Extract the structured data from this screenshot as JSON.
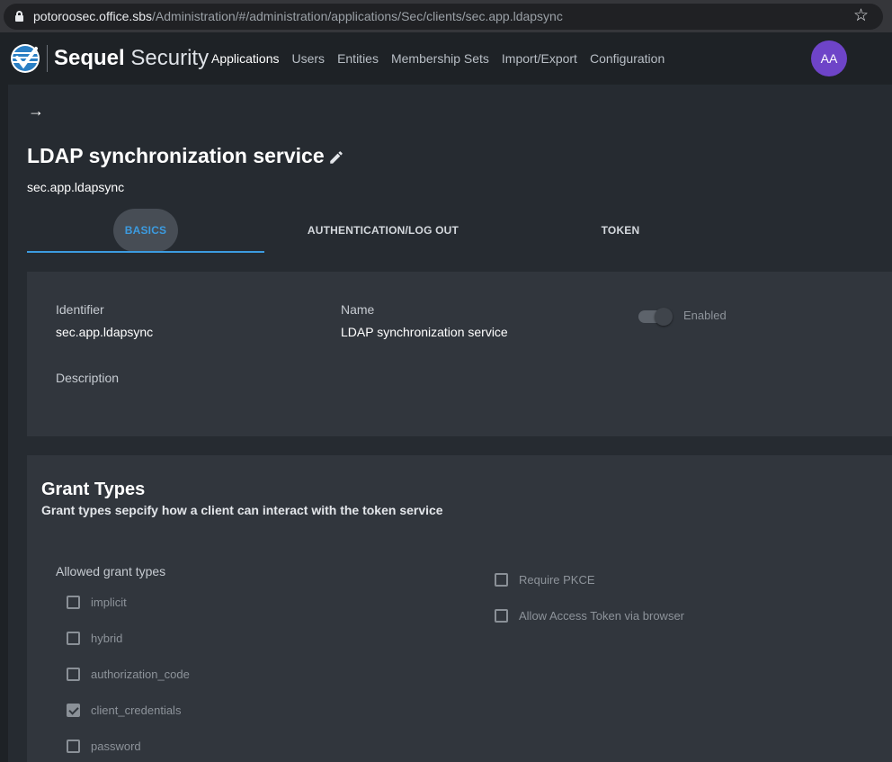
{
  "browser": {
    "url_host": "potoroosec.office.sbs",
    "url_path": "/Administration/#/administration/applications/Sec/clients/sec.app.ldapsync",
    "lock_icon": "lock-icon",
    "bookmark_icon": "star-icon"
  },
  "header": {
    "brand_bold": "Sequel",
    "brand_light": "Security",
    "nav": [
      {
        "label": "Applications",
        "active": true
      },
      {
        "label": "Users",
        "active": false
      },
      {
        "label": "Entities",
        "active": false
      },
      {
        "label": "Membership Sets",
        "active": false
      },
      {
        "label": "Import/Export",
        "active": false
      },
      {
        "label": "Configuration",
        "active": false
      }
    ],
    "avatar_initials": "AA",
    "avatar_color": "#6e44c8"
  },
  "page": {
    "back_icon": "→",
    "title": "LDAP synchronization service",
    "subtitle": "sec.app.ldapsync"
  },
  "tabs": [
    {
      "label": "BASICS",
      "active": true
    },
    {
      "label": "AUTHENTICATION/LOG OUT",
      "active": false
    },
    {
      "label": "TOKEN",
      "active": false
    }
  ],
  "basics": {
    "identifier_label": "Identifier",
    "identifier_value": "sec.app.ldapsync",
    "name_label": "Name",
    "name_value": "LDAP synchronization service",
    "enabled_label": "Enabled",
    "enabled": true,
    "description_label": "Description"
  },
  "grant_types": {
    "title": "Grant Types",
    "subtitle": "Grant types sepcify how a client can interact with the token service",
    "allowed_label": "Allowed grant types",
    "options": [
      {
        "label": "implicit",
        "checked": false
      },
      {
        "label": "hybrid",
        "checked": false
      },
      {
        "label": "authorization_code",
        "checked": false
      },
      {
        "label": "client_credentials",
        "checked": true
      },
      {
        "label": "password",
        "checked": false
      }
    ],
    "require_pkce_label": "Require PKCE",
    "require_pkce": false,
    "allow_access_token_label": "Allow Access Token via browser",
    "allow_access_token": false
  },
  "colors": {
    "accent": "#3c9be0",
    "background": "#262b31",
    "card": "#31363d",
    "header": "#1e2226"
  }
}
